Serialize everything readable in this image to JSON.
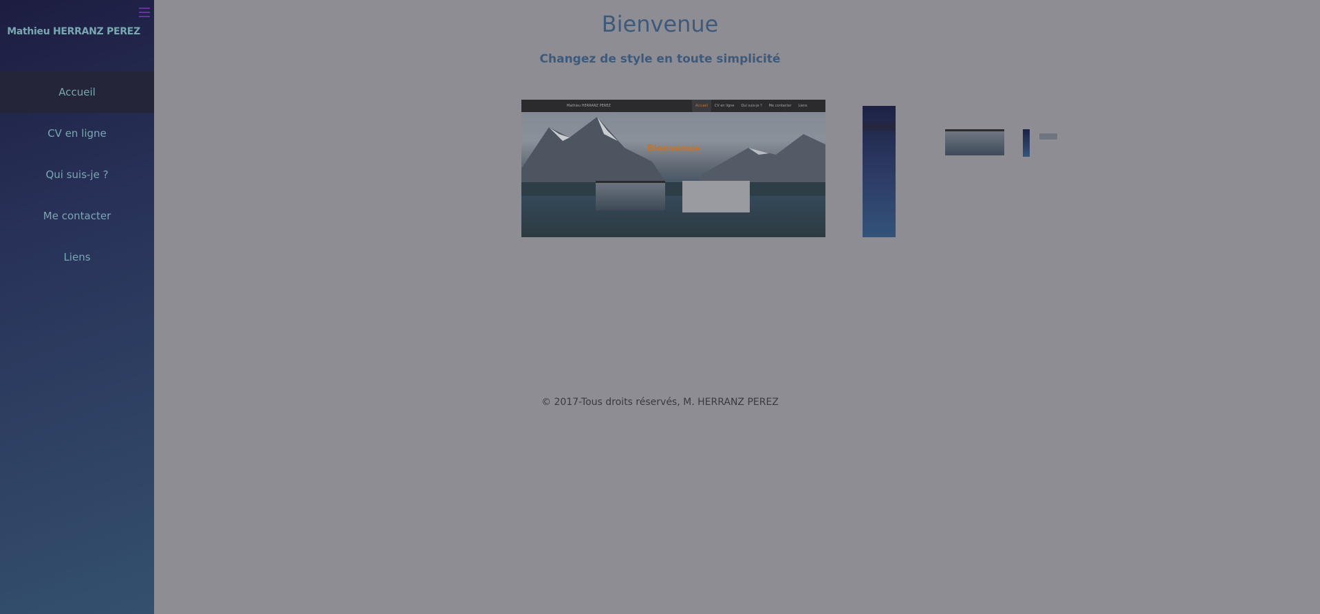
{
  "sidebar": {
    "brand": "Mathieu HERRANZ PEREZ",
    "items": [
      {
        "label": "Accueil",
        "active": true
      },
      {
        "label": "CV en ligne",
        "active": false
      },
      {
        "label": "Qui suis-je ?",
        "active": false
      },
      {
        "label": "Me contacter",
        "active": false
      },
      {
        "label": "Liens",
        "active": false
      }
    ]
  },
  "main": {
    "title": "Bienvenue",
    "subtitle": "Changez de style en toute simplicité",
    "footer": "© 2017-Tous droits réservés, M. HERRANZ PEREZ"
  },
  "previews": {
    "desktop": {
      "brand": "Mathieu HERRANZ PEREZ",
      "menu": [
        "Accueil",
        "CV en ligne",
        "Qui suis-je ?",
        "Me contacter",
        "Liens"
      ],
      "title": "Bienvenue"
    }
  },
  "colors": {
    "sidebar_top": "#1c1d40",
    "sidebar_bottom": "#34506e",
    "page_bg": "#8e8d93",
    "heading": "#3e5a7a",
    "nav_text": "#7aa7b2",
    "accent_orange": "#c0752e"
  },
  "icons": {
    "menu": "hamburger-icon"
  }
}
